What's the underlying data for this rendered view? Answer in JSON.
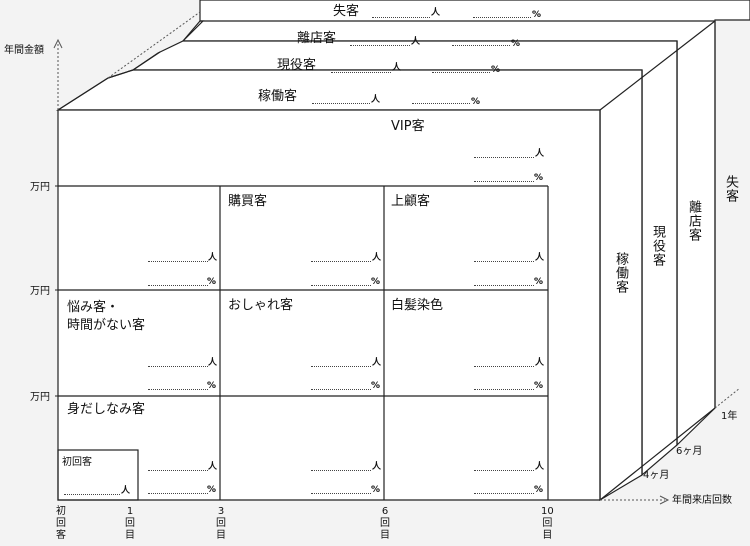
{
  "units": {
    "person": "人",
    "percent": "%"
  },
  "axes": {
    "y_label": "年間金額",
    "x_label": "年間来店回数",
    "y_ticks": [
      "万円",
      "万円",
      "万円"
    ],
    "x_ticks": [
      "初\n回\n客",
      "1\n回\n目",
      "3\n回\n目",
      "6\n回\n目",
      "10\n回\n目"
    ],
    "depth_ticks": [
      "4ヶ月",
      "6ヶ月",
      "1年"
    ]
  },
  "layers": {
    "shikkyaku": "失客",
    "riten": "離店客",
    "geneki": "現役客",
    "kadou": "稼働客"
  },
  "cells": {
    "vip": "VIP客",
    "kobai": "購買客",
    "jouko": "上顧客",
    "nayami": "悩み客・\n時間がない客",
    "oshare": "おしゃれ客",
    "hakuhatsu": "白髪染色",
    "midashinami": "身だしなみ客",
    "shokai": "初回客"
  }
}
